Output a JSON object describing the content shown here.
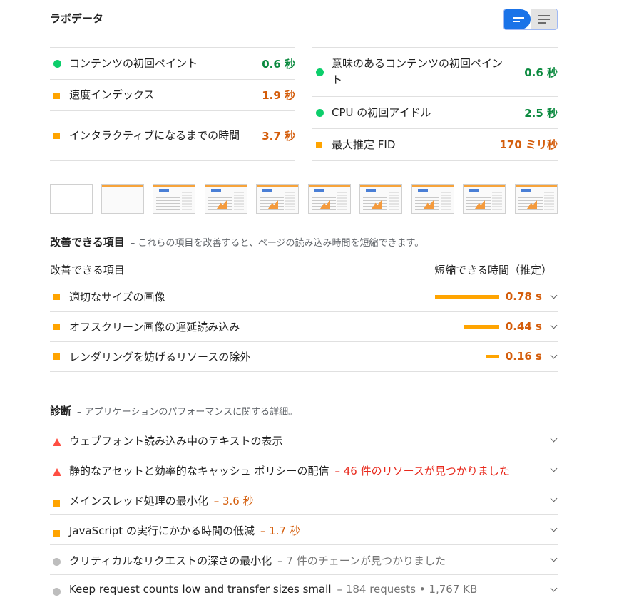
{
  "header": {
    "title": "ラボデータ"
  },
  "metrics": {
    "left": [
      {
        "label": "コンテンツの初回ペイント",
        "value": "0.6 秒",
        "status": "pass"
      },
      {
        "label": "速度インデックス",
        "value": "1.9 秒",
        "status": "average"
      },
      {
        "label": "インタラクティブになるまでの時間",
        "value": "3.7 秒",
        "status": "average"
      }
    ],
    "right": [
      {
        "label": "意味のあるコンテンツの初回ペイント",
        "value": "0.6 秒",
        "status": "pass"
      },
      {
        "label": "CPU の初回アイドル",
        "value": "2.5 秒",
        "status": "pass"
      },
      {
        "label": "最大推定 FID",
        "value": "170 ミリ秒",
        "status": "average"
      }
    ]
  },
  "opportunities": {
    "title": "改善できる項目",
    "description": "– これらの項目を改善すると、ページの読み込み時間を短縮できます。",
    "column_item": "改善できる項目",
    "column_savings": "短縮できる時間（推定）",
    "items": [
      {
        "label": "適切なサイズの画像",
        "value": "0.78 s",
        "savings_fraction": 1.0
      },
      {
        "label": "オフスクリーン画像の遅延読み込み",
        "value": "0.44 s",
        "savings_fraction": 0.56
      },
      {
        "label": "レンダリングを妨げるリソースの除外",
        "value": "0.16 s",
        "savings_fraction": 0.21
      }
    ]
  },
  "diagnostics": {
    "title": "診断",
    "description": "– アプリケーションのパフォーマンスに関する詳細。",
    "items": [
      {
        "label": "ウェブフォント読み込み中のテキストの表示",
        "detail": "",
        "status": "fail"
      },
      {
        "label": "静的なアセットと効率的なキャッシュ ポリシーの配信",
        "detail": "– 46 件のリソースが見つかりました",
        "status": "fail"
      },
      {
        "label": "メインスレッド処理の最小化",
        "detail": "– 3.6 秒",
        "status": "average"
      },
      {
        "label": "JavaScript の実行にかかる時間の低減",
        "detail": "– 1.7 秒",
        "status": "average"
      },
      {
        "label": "クリティカルなリクエストの深さの最小化",
        "detail": "– 7 件のチェーンが見つかりました",
        "status": "info"
      },
      {
        "label": "Keep request counts low and transfer sizes small",
        "detail": "– 184 requests • 1,767 KB",
        "status": "info"
      }
    ]
  },
  "colors": {
    "pass": "#0cce6b",
    "average": "#ffa400",
    "fail": "#ff4e42",
    "info": "#bdbdbd",
    "accent": "#1a73e8"
  }
}
